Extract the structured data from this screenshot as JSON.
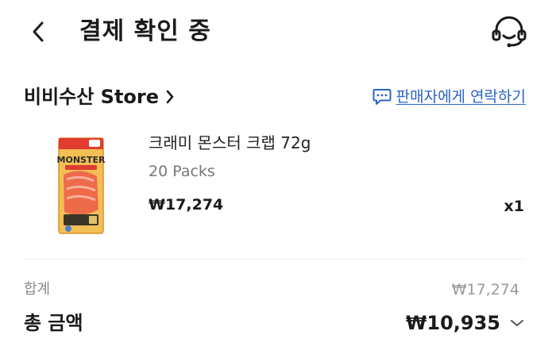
{
  "header": {
    "title": "결제 확인 중",
    "back_icon": "chevron-left-icon",
    "support_icon": "headset-icon"
  },
  "store": {
    "name": "비비수산 Store",
    "chevron_icon": "chevron-right-icon",
    "contact_label": "판매자에게 연락하기",
    "contact_icon": "chat-bubble-icon",
    "link_color": "#2a63c4"
  },
  "product": {
    "title": "크래미 몬스터 크랩 72g",
    "option": "20 Packs",
    "price": "₩17,274",
    "quantity": "x1",
    "image_text": "MONSTER"
  },
  "summary": {
    "subtotal_label": "합계",
    "subtotal_value": "₩17,274",
    "total_label": "총 금액",
    "total_value": "₩10,935",
    "expand_icon": "chevron-down-icon"
  }
}
